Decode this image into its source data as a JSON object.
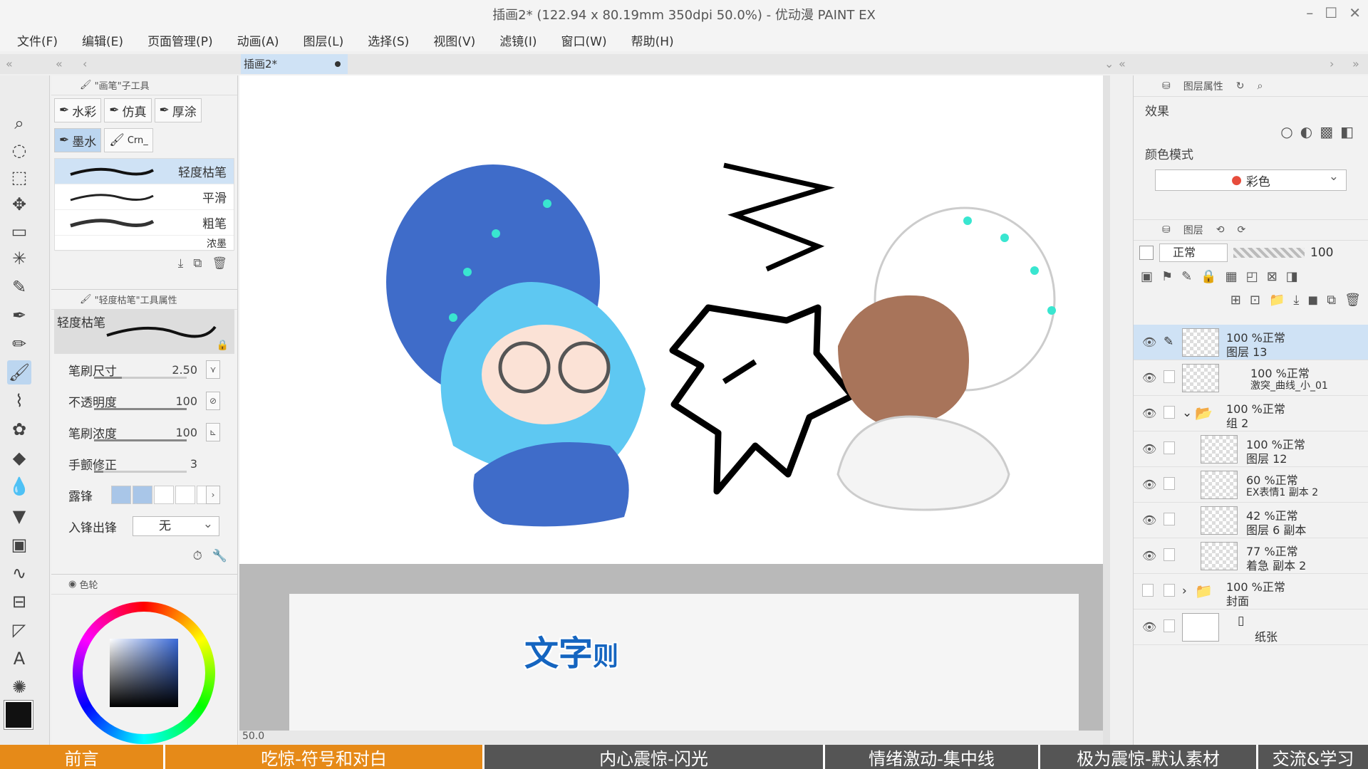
{
  "window": {
    "title": "插画2* (122.94 x 80.19mm 350dpi 50.0%) - 优动漫 PAINT EX"
  },
  "menu": [
    "文件(F)",
    "编辑(E)",
    "页面管理(P)",
    "动画(A)",
    "图层(L)",
    "选择(S)",
    "视图(V)",
    "滤镜(I)",
    "窗口(W)",
    "帮助(H)"
  ],
  "document_tab": {
    "label": "插画2*"
  },
  "subtool": {
    "header": "\"画笔\"子工具",
    "tabs": [
      "水彩",
      "仿真",
      "厚涂",
      "墨水",
      "Crn_"
    ],
    "brushes": [
      "轻度枯笔",
      "平滑",
      "粗笔",
      "浓墨"
    ],
    "selected_brush": "轻度枯笔"
  },
  "tool_property": {
    "header": "\"轻度枯笔\"工具属性",
    "brush_name": "轻度枯笔",
    "brush_size_label": "笔刷尺寸",
    "brush_size": "2.50",
    "opacity_label": "不透明度",
    "opacity": "100",
    "density_label": "笔刷浓度",
    "density": "100",
    "stabilization_label": "手颤修正",
    "stabilization": "3",
    "taper_label": "露锋",
    "taper_in_out_label": "入锋出锋",
    "taper_in_out_value": "无"
  },
  "color_panel": {
    "header": "色轮",
    "fg_color": "#111111"
  },
  "canvas": {
    "caption_main": "文字",
    "caption_suffix": "则",
    "zoom": "50.0"
  },
  "right_panel": {
    "layer_property_header": "图层属性",
    "effect_label": "效果",
    "color_mode_label": "颜色模式",
    "color_mode_value": "彩色",
    "layer_header": "图层",
    "blend_mode": "正常",
    "opacity": "100",
    "layers": [
      {
        "mode": "100 %正常",
        "name": "图层 13",
        "selected": true
      },
      {
        "mode": "100 %正常",
        "name": "激突_曲线_小_01"
      },
      {
        "mode": "100 %正常",
        "name": "组 2"
      },
      {
        "mode": "100 %正常",
        "name": "图层 12"
      },
      {
        "mode": "60 %正常",
        "name": "EX表情1 副本 2"
      },
      {
        "mode": "42 %正常",
        "name": "图层 6 副本"
      },
      {
        "mode": "77 %正常",
        "name": "着急 副本 2"
      },
      {
        "mode": "100 %正常",
        "name": "封面"
      },
      {
        "mode": "",
        "name": "纸张"
      }
    ]
  },
  "chapters": [
    "前言",
    "吃惊-符号和对白",
    "内心震惊-闪光",
    "情绪激动-集中线",
    "极为震惊-默认素材",
    "交流&学习"
  ],
  "colors": {
    "accent": "#1565c0",
    "chapter_orange": "#e68a18",
    "chapter_grey": "#555555",
    "selection": "#cfe2f5"
  }
}
